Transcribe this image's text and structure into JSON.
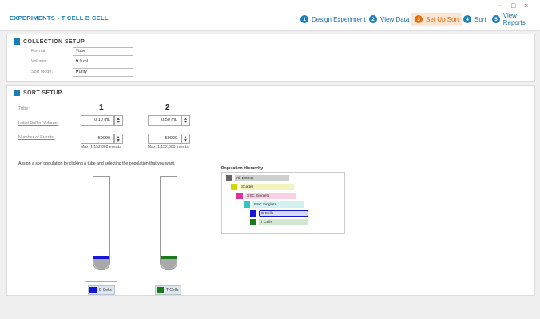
{
  "window_controls": {
    "minimize": "−",
    "maximize": "□",
    "close": "×"
  },
  "breadcrumb": "EXPERIMENTS › T CELL B CELL",
  "steps": [
    {
      "num": "1",
      "label": "Design Experiment"
    },
    {
      "num": "2",
      "label": "View Data"
    },
    {
      "num": "3",
      "label": "Set Up Sort"
    },
    {
      "num": "4",
      "label": "Sort"
    },
    {
      "num": "5",
      "label": "View Reports"
    }
  ],
  "active_step": "Set Up Sort",
  "collection_setup": {
    "title": "COLLECTION SETUP",
    "fields": [
      {
        "label": "Format:",
        "value": "Tube"
      },
      {
        "label": "Volume:",
        "value": "5.0 mL"
      },
      {
        "label": "Sort Mode:",
        "value": "Purity"
      }
    ]
  },
  "sort_setup": {
    "title": "SORT SETUP",
    "tube_label": "Tube:",
    "initial_buffer_label": "Initial Buffer Volume:",
    "number_events_label": "Number of Events:",
    "tubes": [
      {
        "num": "1",
        "buffer": "0.10 mL",
        "events": "50000",
        "max": "Max: 1,152,000 events",
        "tag": "B Cells",
        "color": "#1616d8"
      },
      {
        "num": "2",
        "buffer": "0.50 mL",
        "events": "50000",
        "max": "Max: 1,152,000 events",
        "tag": "T Cells",
        "color": "#197a19"
      }
    ],
    "instruction": "Assign a sort population by clicking a tube and selecting the population that you want."
  },
  "population_hierarchy": {
    "title": "Population Hierarchy",
    "items": [
      {
        "label": "All Events",
        "color": "#666666",
        "bar": "#cfcfcf"
      },
      {
        "label": "Scatter",
        "color": "#d6d600",
        "bar": "#f4f4c0"
      },
      {
        "label": "SSC Singlets",
        "color": "#e0309a",
        "bar": "#f9d0e6"
      },
      {
        "label": "FSC Singlets",
        "color": "#30c4c4",
        "bar": "#d2f2f2"
      },
      {
        "label": "B Cells",
        "color": "#1616d8",
        "bar": "#d6dcf4"
      },
      {
        "label": "T Cells",
        "color": "#197a19",
        "bar": "#cfe8cf"
      }
    ]
  }
}
